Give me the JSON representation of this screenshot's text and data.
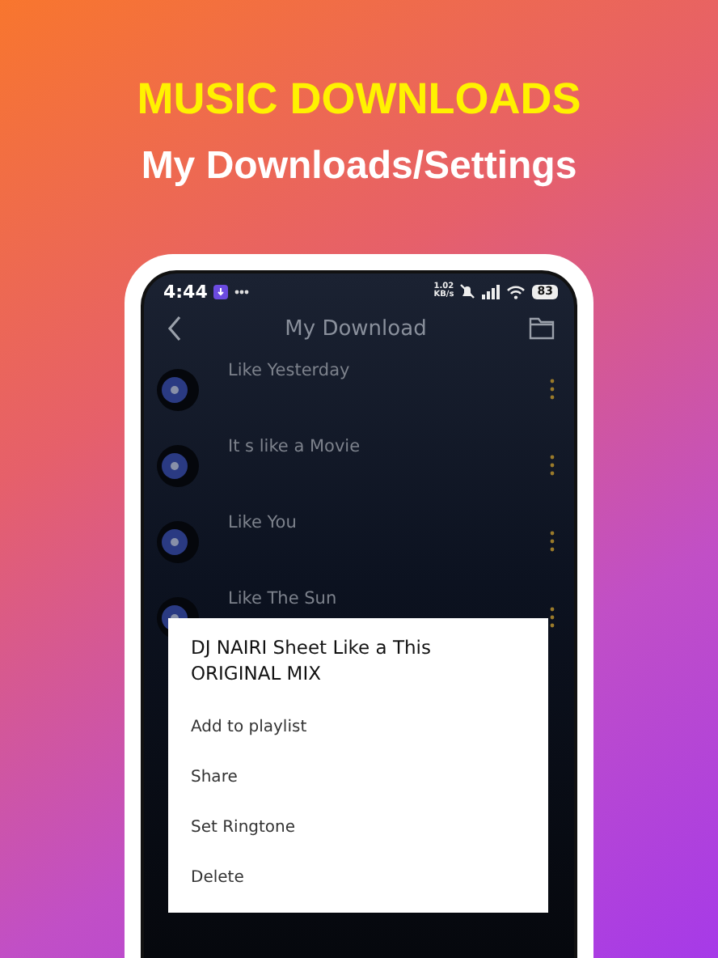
{
  "promo": {
    "headline": "MUSIC DOWNLOADS",
    "subtitle": "My Downloads/Settings"
  },
  "status_bar": {
    "time": "4:44",
    "net_speed": "1.02 KB/s",
    "battery": "83"
  },
  "header": {
    "title": "My Download"
  },
  "songs": [
    {
      "title": "Like Yesterday"
    },
    {
      "title": "It s like a Movie"
    },
    {
      "title": "Like You"
    },
    {
      "title": "Like The Sun"
    }
  ],
  "menu": {
    "title": "DJ NAIRI Sheet Like a This ORIGINAL MIX",
    "items": [
      "Add to playlist",
      "Share",
      "Set Ringtone",
      "Delete"
    ]
  }
}
